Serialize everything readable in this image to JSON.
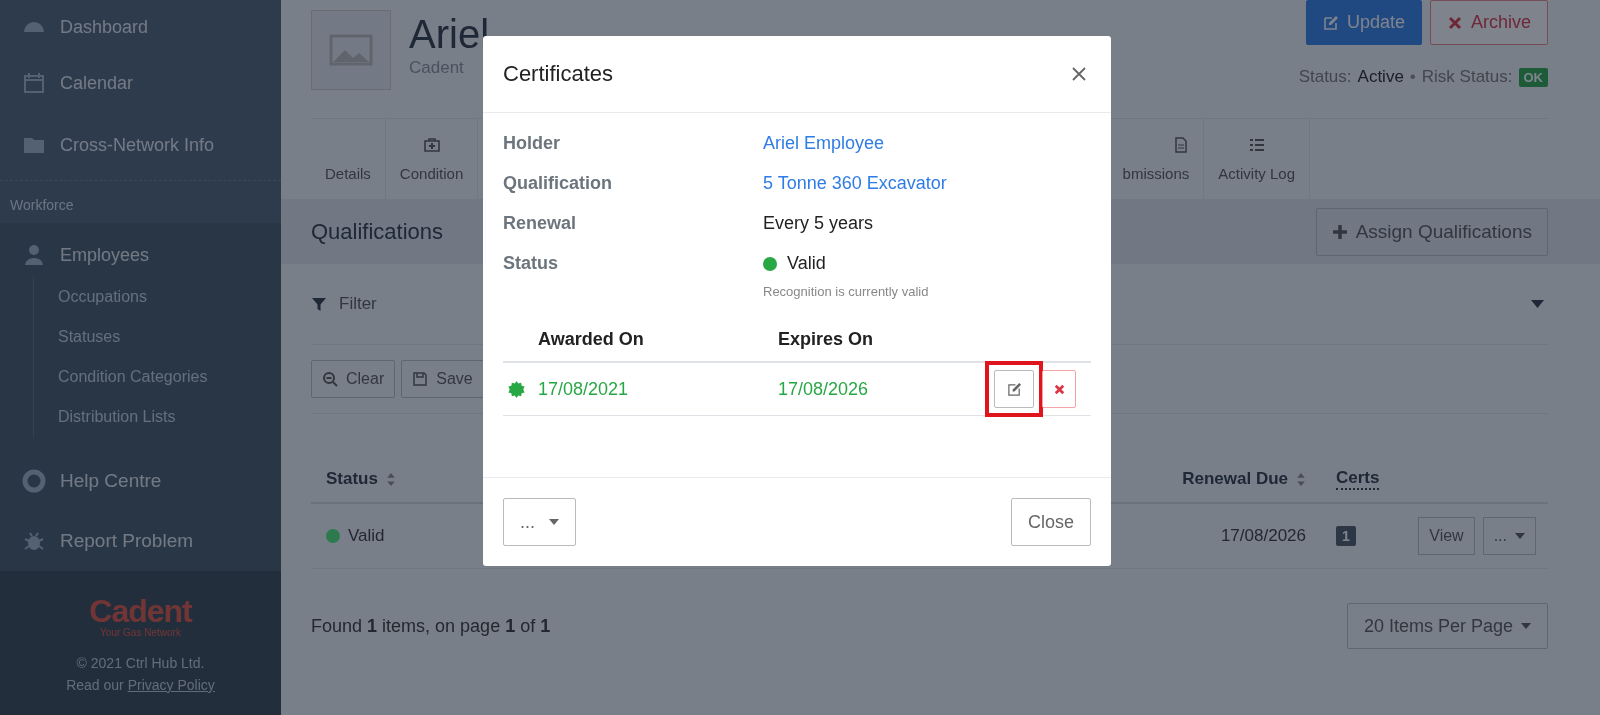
{
  "sidebar": {
    "top_items": [
      "Dashboard",
      "Calendar",
      "Cross-Network Info"
    ],
    "section_label": "Workforce",
    "section_item": "Employees",
    "sub_items": [
      "Occupations",
      "Statuses",
      "Condition Categories",
      "Distribution Lists"
    ],
    "bottom_items": [
      "Help Centre",
      "Report Problem"
    ],
    "footer": {
      "brand": "Cadent",
      "tagline": "Your Gas Network",
      "copyright": "© 2021 Ctrl Hub Ltd.",
      "privacy_prefix": "Read our",
      "privacy_link": "Privacy Policy"
    }
  },
  "header": {
    "title": "Ariel",
    "subtitle": "Cadent",
    "buttons": [
      {
        "kind": "update",
        "label": "Update"
      },
      {
        "kind": "archive",
        "label": "Archive"
      }
    ],
    "status_label": "Status:",
    "status_value": "Active",
    "separator": "•",
    "risk_label": "Risk Status:",
    "risk_value": "OK"
  },
  "tabs_left": [
    {
      "label": "Details"
    },
    {
      "label": "Condition"
    }
  ],
  "tabs_right": [
    {
      "label": "bmissions"
    },
    {
      "label": "Activity Log"
    }
  ],
  "panel": {
    "title": "Qualifications",
    "assign_button": "Assign Qualifications",
    "filter_label": "Filter",
    "buttons": [
      "Clear",
      "Save"
    ]
  },
  "table": {
    "columns": [
      {
        "label": "Status",
        "sortable": true
      },
      {
        "label": "Renewal Due",
        "sortable": true
      },
      {
        "label": "Certs",
        "sortable": false
      }
    ],
    "rows": [
      {
        "status": "Valid",
        "color": "#2d7a4f",
        "renewal_due": "17/08/2026",
        "certs": "1",
        "view": "View",
        "more": "..."
      }
    ]
  },
  "footer": {
    "summary": "Found **1** items, on page **1** of **1**",
    "page_size": "20 Items Per Page"
  },
  "modal": {
    "title": "Certificates",
    "fields": [
      {
        "label": "Holder",
        "value": "Ariel Employee",
        "kind": "link"
      },
      {
        "label": "Qualification",
        "value": "5 Tonne 360 Excavator",
        "kind": "link"
      },
      {
        "label": "Renewal",
        "value": "Every 5 years",
        "kind": "text"
      },
      {
        "label": "Status",
        "value": "Valid",
        "kind": "status",
        "color": "#28a745",
        "note": "Recognition is currently valid"
      }
    ],
    "cert_columns": [
      "Awarded On",
      "Expires On"
    ],
    "certs": [
      {
        "awarded_on": "17/08/2021",
        "expires_on": "17/08/2026",
        "color": "#28a745",
        "actions": [
          {
            "kind": "edit",
            "highlighted": true
          },
          {
            "kind": "delete",
            "highlighted": false
          }
        ]
      }
    ],
    "more_button": "...",
    "close_button": "Close"
  }
}
